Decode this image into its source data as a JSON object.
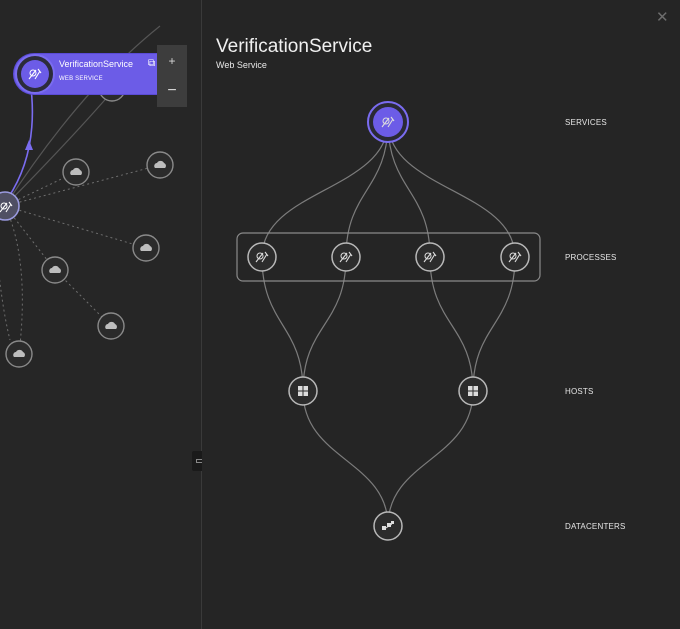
{
  "colors": {
    "accent": "#6c5ce7",
    "accent_border": "#7a6cf0",
    "node_stroke": "#9a9a9a",
    "edge": "#7c7c7c"
  },
  "left_graph": {
    "selected_node": {
      "name": "VerificationService",
      "type": "WEB SERVICE",
      "icon": "service-icon",
      "action_icon": "external-link-icon"
    },
    "zoom_in_label": "+",
    "zoom_out_label": "−",
    "nodes": [
      "service-icon",
      "cloud-icon",
      "cloud-icon",
      "cloud-icon",
      "cloud-icon",
      "cloud-icon",
      "cloud-icon",
      "cloud-icon"
    ]
  },
  "detail": {
    "title": "VerificationService",
    "subtitle": "Web Service",
    "close_icon": "close-icon",
    "levels": [
      "SERVICES",
      "PROCESSES",
      "HOSTS",
      "DATACENTERS"
    ],
    "stack": {
      "services": [
        {
          "icon": "service-icon",
          "selected": true
        }
      ],
      "processes": [
        {
          "icon": "process-icon"
        },
        {
          "icon": "process-icon"
        },
        {
          "icon": "process-icon"
        },
        {
          "icon": "process-icon"
        }
      ],
      "hosts": [
        {
          "icon": "windows-icon"
        },
        {
          "icon": "windows-icon"
        }
      ],
      "datacenters": [
        {
          "icon": "datacenter-icon"
        }
      ]
    }
  }
}
